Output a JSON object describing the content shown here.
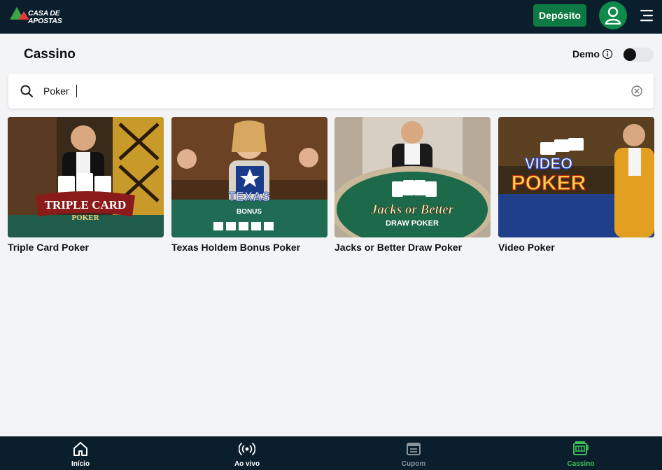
{
  "header": {
    "logo_line1": "CASA DE",
    "logo_line2": "APOSTAS",
    "deposit_label": "Depósito",
    "brand_green": "#0e7a43",
    "dark_bg": "#0b1e2c"
  },
  "page": {
    "title": "Cassino",
    "demo_label": "Demo",
    "demo_enabled": false
  },
  "search": {
    "value": "Poker",
    "placeholder": ""
  },
  "games": [
    {
      "name": "Triple Card Poker",
      "art": "TRIPLE CARD",
      "art_sub": "POKER"
    },
    {
      "name": "Texas Holdem Bonus Poker",
      "art": "TEXAS",
      "art_sub": "BONUS"
    },
    {
      "name": "Jacks or Better Draw Poker",
      "art": "Jacks or Better",
      "art_sub": "DRAW POKER"
    },
    {
      "name": "Video Poker",
      "art": "VIDEO",
      "art_sub": "POKER"
    }
  ],
  "bottom_nav": [
    {
      "label": "Início",
      "icon": "home-icon",
      "color": "#ffffff"
    },
    {
      "label": "Ao vivo",
      "icon": "live-icon",
      "color": "#ffffff"
    },
    {
      "label": "Cupom",
      "icon": "coupon-icon",
      "color": "#8a949c"
    },
    {
      "label": "Cassino",
      "icon": "slot-machine-icon",
      "color": "#3fbf5a"
    }
  ]
}
